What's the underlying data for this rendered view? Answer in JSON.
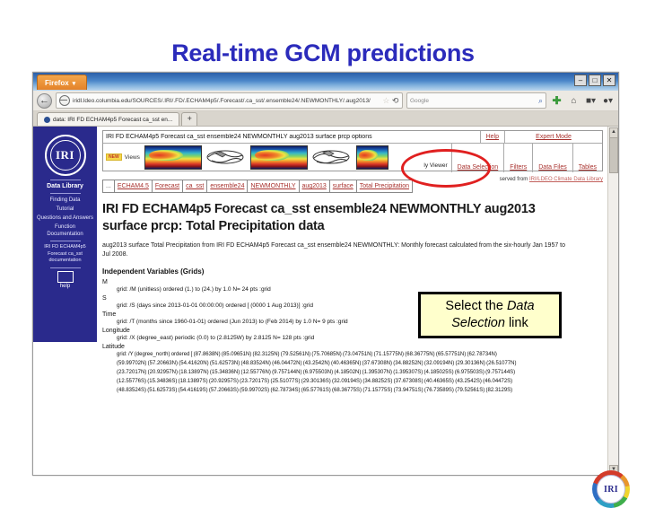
{
  "slide": {
    "title": "Real-time GCM predictions",
    "title_color": "#2b2bbb"
  },
  "browser": {
    "app_name": "Firefox",
    "tab_caret": "▾",
    "window_buttons": {
      "minimize": "–",
      "maximize": "□",
      "close": "✕"
    },
    "back_arrow": "←",
    "url": "iridl.ldeo.columbia.edu/SOURCES/.IRI/.FD/.ECHAM4p5/.Forecast/.ca_sst/.ensemble24/.NEWMONTHLY/.aug2013/",
    "url_domain": "iridl.ldeo.columbia.edu",
    "star_icon": "☆",
    "reload_icon": "⟳",
    "search_placeholder": "Google",
    "search_icon": "⌕",
    "toolbar_icons": [
      "plus-icon",
      "home-icon",
      "bookmarks-icon",
      "account-icon"
    ],
    "page_tab_title": "data: IRI FD ECHAM4p5 Forecast ca_sst en...",
    "new_tab_label": "+"
  },
  "sidebar": {
    "logo_text": "IRI",
    "title": "Data Library",
    "items": [
      {
        "label": "Finding Data"
      },
      {
        "label": "Tutorial"
      },
      {
        "label": "Questions and Answers"
      },
      {
        "label": "Function Documentation"
      }
    ],
    "doc_item": "IRI FD ECHAM4p5 Forecast ca_sst documentation",
    "help_label": "help"
  },
  "optbar": {
    "dataset_title": "IRI FD ECHAM4p5 Forecast ca_sst ensemble24 NEWMONTHLY aug2013 surface prcp options",
    "help_link": "Help",
    "expert_mode_link": "Expert Mode",
    "new_badge": "NEW",
    "views_label": "Views",
    "viewer_label": "ly Viewer",
    "nav_links": [
      "Data Selection",
      "Filters",
      "Data Files",
      "Tables"
    ],
    "highlighted_link": "Data Selection"
  },
  "breadcrumb": {
    "ellipsis": "...",
    "segments": [
      "ECHAM4.5",
      "Forecast",
      "ca_sst",
      "ensemble24",
      "NEWMONTHLY",
      "aug2013",
      "surface",
      "Total Precipitation"
    ]
  },
  "served_from": {
    "prefix": "served from ",
    "link": "IRI/LDEO Climate Data Library"
  },
  "page": {
    "heading_line1": "IRI FD ECHAM4p5 Forecast ca_sst ensemble24 NEWMONTHLY aug2013",
    "heading_line2": "surface prcp: Total Precipitation data",
    "description": "aug2013 surface Total Precipitation from IRI FD ECHAM4p5 Forecast ca_sst ensemble24 NEWMONTHLY: Monthly forecast calculated from the six-hourly Jan 1957 to Jul 2008.",
    "section_heading": "Independent Variables (Grids)",
    "grids": [
      {
        "name": "M",
        "line": "grid: /M (unitless) ordered (1.) to (24.) by 1.0 N= 24 pts :grid"
      },
      {
        "name": "S",
        "line": "grid: /S (days since 2013-01-01 00:00:00) ordered [ (0000 1 Aug 2013)] :grid"
      },
      {
        "name": "Time",
        "line": "grid: /T (months since 1960-01-01) ordered (Jun 2013) to (Feb 2014) by 1.0 N= 9 pts :grid"
      },
      {
        "name": "Longitude",
        "line": "grid: /X (degree_east) periodic (0.0) to (2.8125W) by 2.8125 N= 128 pts :grid"
      },
      {
        "name": "Latitude",
        "line": "grid: /Y (degree_north) ordered [ (87.8638N) (85.09651N) (82.3125N) (79.52561N) (75.70685N) (73.04751N) (71.15775N) (68.36775N) (65.57751N) (62.78734N)",
        "extra_lines": [
          "(59.99702N) (57.20663N) (54.41620N) (51.62573N) (48.83524N) (46.04472N) (43.2542N) (40.46365N) (37.67308N) (34.88252N) (32.09194N) (29.30136N) (26.51077N)",
          "(23.72017N) (20.92957N) (18.13897N) (15.34836N) (12.55776N) (9.757144N) (6.975503N) (4.18502N) (1.395307N) (1.395307S) (4.185025S) (6.975503S) (9.757144S)",
          "(12.55776S) (15.34836S) (18.13897S) (20.92957S) (23.72017S) (25.51077S) (29.30136S) (32.09194S) (34.88252S) (37.67308S) (40.46365S) (43.2542S) (46.04472S)",
          "(48.83524S) (51.62573S) (54.41619S) (57.20663S) (59.99702S) (62.78734S) (65.57761S) (68.36775S) (71.15775S) (73.94751S) (76.73589S) (79.52561S) (82.3129S)"
        ]
      }
    ]
  },
  "callout": {
    "text_before": "Select the ",
    "text_italic": "Data Selection",
    "text_after": " link",
    "background": "#ffffcc",
    "border": "#000000"
  },
  "annotation": {
    "circle_color": "#e02020",
    "target": "Data Selection"
  },
  "footer_seal": {
    "text": "IRI"
  }
}
